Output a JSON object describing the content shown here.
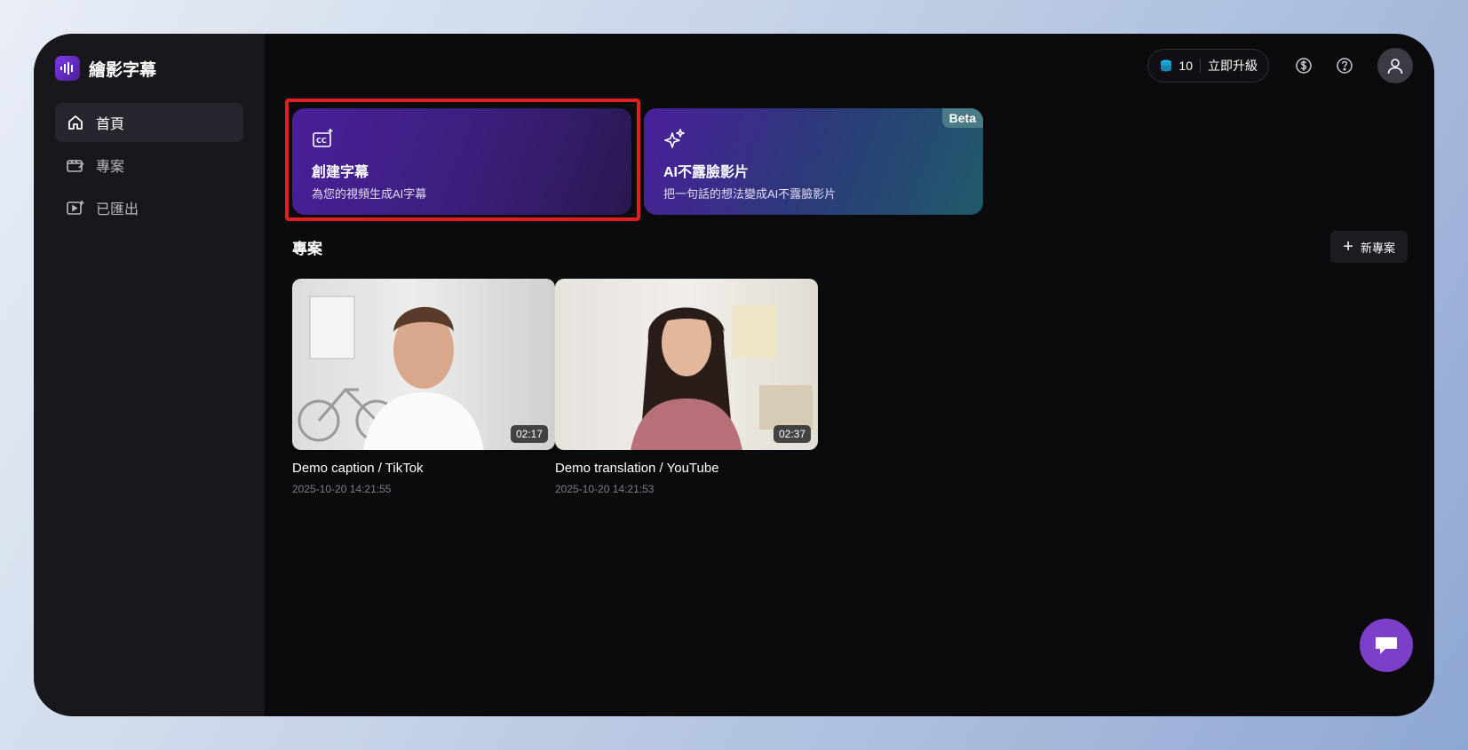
{
  "app": {
    "name": "繪影字幕"
  },
  "sidebar": {
    "items": [
      {
        "label": "首頁",
        "icon": "home-icon",
        "active": true
      },
      {
        "label": "專案",
        "icon": "projects-icon",
        "active": false
      },
      {
        "label": "已匯出",
        "icon": "exported-icon",
        "active": false
      }
    ]
  },
  "topbar": {
    "credits": "10",
    "upgrade_label": "立即升級"
  },
  "cards": {
    "create": {
      "title": "創建字幕",
      "subtitle": "為您的視頻生成AI字幕"
    },
    "ai": {
      "title": "AI不露臉影片",
      "subtitle": "把一句話的想法變成AI不露臉影片",
      "badge": "Beta"
    }
  },
  "projects_section": {
    "title": "專案",
    "new_label": "新專案",
    "items": [
      {
        "name": "Demo caption / TikTok",
        "date": "2025-10-20 14:21:55",
        "duration": "02:17"
      },
      {
        "name": "Demo translation / YouTube",
        "date": "2025-10-20 14:21:53",
        "duration": "02:37"
      }
    ]
  },
  "colors": {
    "accent": "#7c3fc9",
    "highlight": "#e0201f"
  }
}
